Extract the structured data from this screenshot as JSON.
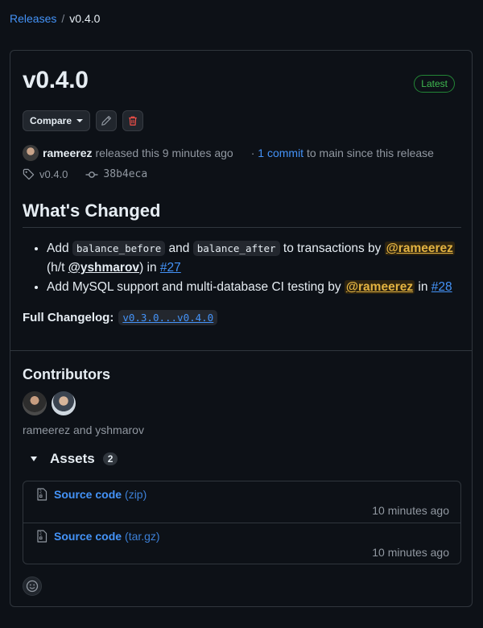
{
  "breadcrumb": {
    "root": "Releases",
    "sep": "/",
    "current": "v0.4.0"
  },
  "release": {
    "title": "v0.4.0",
    "badge": "Latest",
    "compare_label": "Compare",
    "author": "rameerez",
    "released_text": "released this 9 minutes ago",
    "dot": "·",
    "commits_link": "1 commit",
    "commits_suffix": "to main since this release",
    "tag": "v0.4.0",
    "commit_sha": "38b4eca"
  },
  "notes": {
    "heading": "What's Changed",
    "items": [
      {
        "t1": "Add ",
        "code1": "balance_before",
        "t2": " and ",
        "code2": "balance_after",
        "t3": " to transactions by ",
        "mention": "@rameerez",
        "t4": " (h/t ",
        "mention2": "@yshmarov",
        "t5": ") in ",
        "pr": "#27"
      },
      {
        "t1": "Add MySQL support and multi-database CI testing by ",
        "mention": "@rameerez",
        "t2": " in ",
        "pr": "#28"
      }
    ],
    "changelog_label": "Full Changelog:",
    "changelog_link": "v0.3.0...v0.4.0"
  },
  "contributors": {
    "heading": "Contributors",
    "names": "rameerez and yshmarov"
  },
  "assets": {
    "heading": "Assets",
    "count": "2",
    "items": [
      {
        "name": "Source code",
        "format": "(zip)",
        "time": "10 minutes ago"
      },
      {
        "name": "Source code",
        "format": "(tar.gz)",
        "time": "10 minutes ago"
      }
    ]
  },
  "icons": {
    "edit": "pencil-icon",
    "delete": "trash-icon",
    "tag": "tag-icon",
    "commit": "commit-icon",
    "file": "file-zip-icon",
    "reaction": "smiley-icon"
  },
  "colors": {
    "background": "#0d1117",
    "link": "#4493f8",
    "latest": "#3fb950",
    "delete": "#f85149",
    "mention": "#e3b341"
  }
}
